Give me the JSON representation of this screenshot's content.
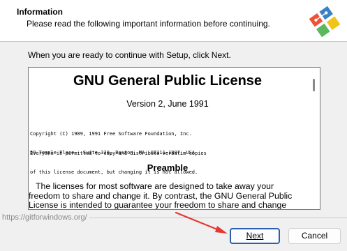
{
  "header": {
    "title": "Information",
    "subtitle": "Please read the following important information before continuing."
  },
  "intro_text": "When you are ready to continue with Setup, click Next.",
  "license": {
    "title": "GNU General Public License",
    "version": "Version 2, June 1991",
    "copyright_lines": [
      "Copyright (C) 1989, 1991 Free Software Foundation, Inc.",
      "59 Temple Place - Suite 330, Boston, MA  02111-1307, USA"
    ],
    "everyone_lines": [
      "Everyone is permitted to copy and distribute verbatim copies",
      "of this license document, but changing it is not allowed."
    ],
    "preamble_heading": "Preamble",
    "body_lines": [
      "   The licenses for most software are designed to take away your",
      "freedom to share and change it. By contrast, the GNU General Public",
      "License is intended to guarantee your freedom to share and change"
    ]
  },
  "footer": {
    "link_text": "https://gitforwindows.org/"
  },
  "buttons": {
    "next_label": "Next",
    "cancel_label": "Cancel"
  },
  "icons": {
    "logo": "git-logo-icon",
    "arrow": "red-arrow-annotation"
  },
  "colors": {
    "accent": "#2b5fb4",
    "arrow": "#e53935",
    "logo_red": "#f05033",
    "logo_blue": "#3b82c4",
    "logo_green": "#5cb85c",
    "logo_yellow": "#f0c419"
  }
}
